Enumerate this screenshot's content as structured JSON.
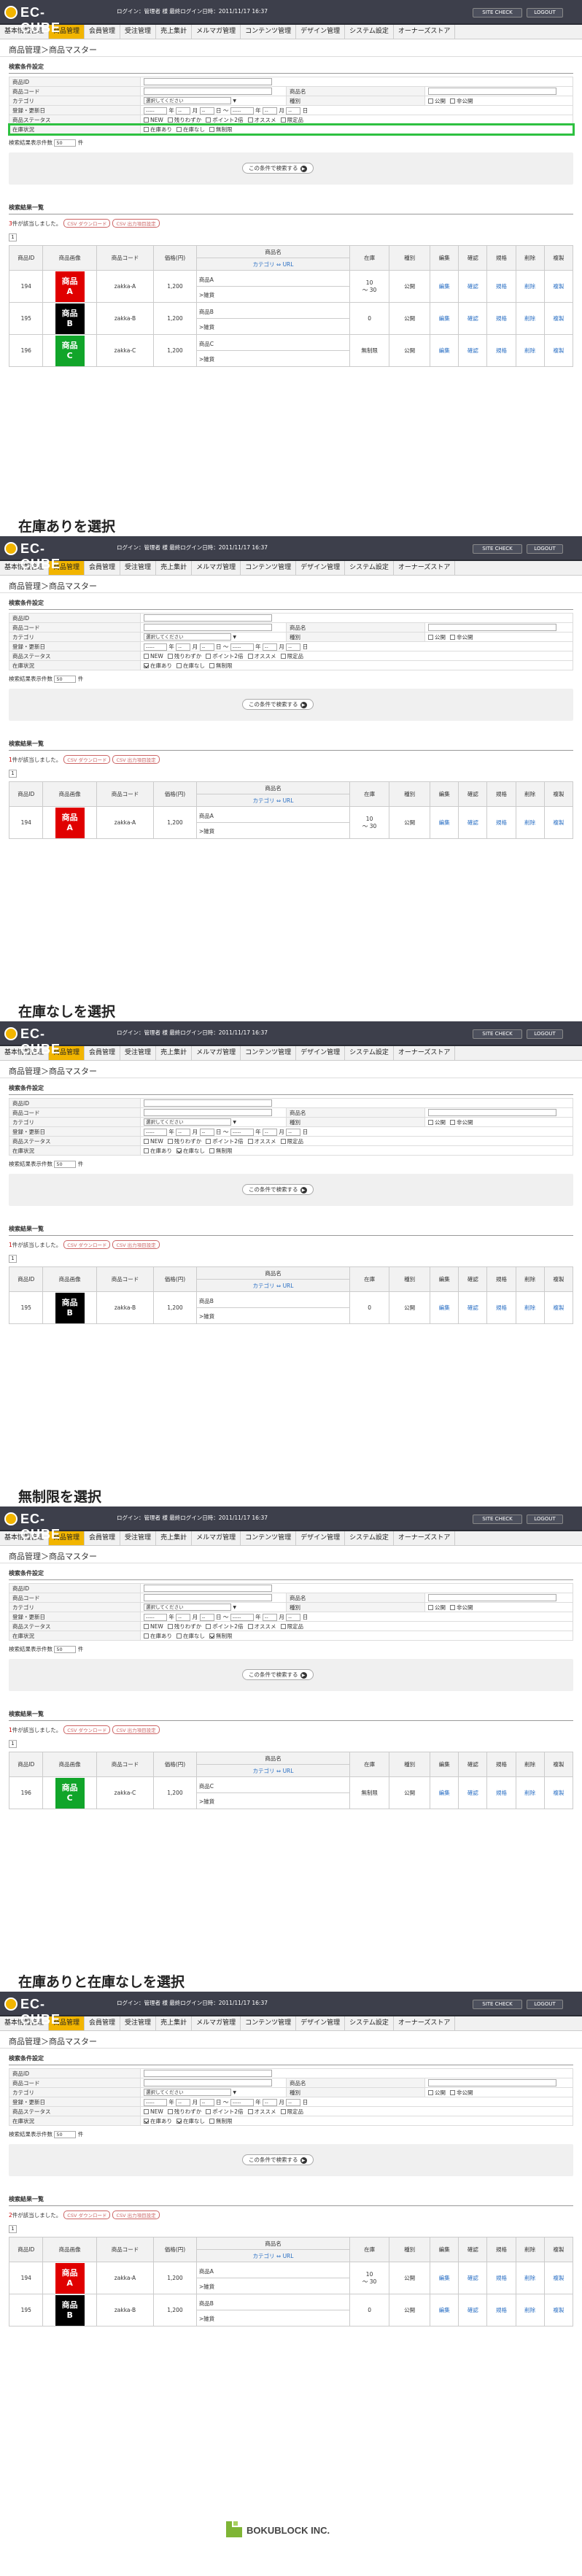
{
  "header": {
    "logo_text": "EC-CUBE",
    "login_text": "ログイン：管理者 様  最終ログイン日時：2011/11/17 16:37",
    "site_check": "SITE CHECK",
    "logout": "LOGOUT"
  },
  "nav": [
    "基本情報管理",
    "商品管理",
    "会員管理",
    "受注管理",
    "売上集計",
    "メルマガ管理",
    "コンテンツ管理",
    "デザイン管理",
    "システム設定",
    "オーナーズストア"
  ],
  "breadcrumb": "商品管理＞商品マスター",
  "search": {
    "section_title": "検索条件設定",
    "product_id": "商品ID",
    "product_code": "商品コード",
    "product_name": "商品名",
    "category": "カテゴリ",
    "category_placeholder": "選択してください",
    "type": "種別",
    "public": "公開",
    "private": "非公開",
    "reg_date": "登録・更新日",
    "date_dash": "-----",
    "year": "年",
    "month": "月",
    "day": "日",
    "tilde": "〜",
    "day_dash": "--",
    "status": "商品ステータス",
    "status_opts": [
      "NEW",
      "残りわずか",
      "ポイント2倍",
      "オススメ",
      "限定品"
    ],
    "stock": "在庫状況",
    "stock_opts": [
      "在庫あり",
      "在庫なし",
      "無制限"
    ],
    "count_label": "検索結果表示件数",
    "count_value": "50",
    "count_unit": "件",
    "search_button": "この条件で検索する"
  },
  "results": {
    "title": "検索結果一覧",
    "found_suffix": "件が該当しました。",
    "csv_download": "CSV ダウンロード",
    "csv_settings": "CSV 出力項目設定",
    "page": "1",
    "headers": [
      "商品ID",
      "商品画像",
      "商品コード",
      "価格(円)",
      "商品名",
      "在庫",
      "種別",
      "編集",
      "確認",
      "規格",
      "削除",
      "複製"
    ],
    "sub_header": "カテゴリ ⇔ URL",
    "edit": "編集",
    "confirm": "確認",
    "spec": "規格",
    "delete": "削除",
    "copy": "複製",
    "published": "公開",
    "category_path": ">雑貨"
  },
  "products": {
    "a": {
      "id": "194",
      "img_line1": "商品",
      "img_line2": "A",
      "color": "#e00000",
      "code": "zakka-A",
      "price": "1,200",
      "name": "商品A",
      "stock_line1": "10",
      "stock_line2": "〜 30"
    },
    "b": {
      "id": "195",
      "img_line1": "商品",
      "img_line2": "B",
      "color": "#000000",
      "code": "zakka-B",
      "price": "1,200",
      "name": "商品B",
      "stock": "0"
    },
    "c": {
      "id": "196",
      "img_line1": "商品",
      "img_line2": "C",
      "color": "#11a52a",
      "code": "zakka-C",
      "price": "1,200",
      "name": "商品C",
      "stock": "無制限"
    }
  },
  "captions": {
    "s2": "在庫ありを選択",
    "s3": "在庫なしを選択",
    "s4": "無制限を選択",
    "s5": "在庫ありと在庫なしを選択"
  },
  "counts": {
    "s1": "3",
    "s2": "1",
    "s3": "1",
    "s4": "1",
    "s5": "2"
  },
  "footer": {
    "brand": "BOKUBLOCK INC.",
    "icon": "bokublock-logo-icon"
  },
  "colors": {
    "accent": "#f2b500",
    "highlight": "#2ec141",
    "header_bg": "#3d3f4b",
    "link": "#2a6fc4"
  }
}
